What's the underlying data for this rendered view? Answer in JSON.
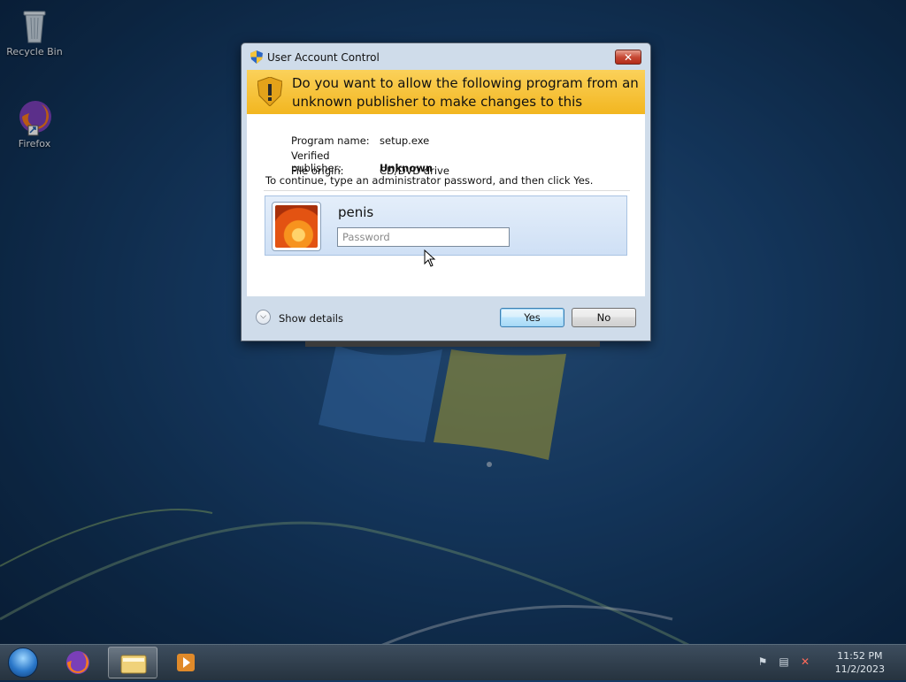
{
  "desktop": {
    "icons": [
      {
        "label": "Recycle Bin",
        "icon": "recycle-bin-icon"
      },
      {
        "label": "Firefox",
        "icon": "firefox-icon"
      }
    ]
  },
  "dialog": {
    "title": "User Account Control",
    "close_label": "✕",
    "banner_text": "Do you want to allow the following program from an unknown publisher to make changes to this computer?",
    "program_name_label": "Program name:",
    "program_name": "setup.exe",
    "publisher_label": "Verified publisher:",
    "publisher": "Unknown",
    "origin_label": "File origin:",
    "origin": "CD/DVD drive",
    "instruction": "To continue, type an administrator password, and then click Yes.",
    "username": "penis",
    "password_placeholder": "Password",
    "show_details": "Show details",
    "yes_label": "Yes",
    "no_label": "No",
    "banner_color": "#f2b620"
  },
  "taskbar": {
    "clock_time": "11:52 PM",
    "clock_date": "11/2/2023",
    "items": [
      {
        "icon": "firefox-icon"
      },
      {
        "icon": "file-explorer-icon",
        "active": true
      },
      {
        "icon": "media-player-icon"
      }
    ],
    "tray": [
      "action-center-flag-icon",
      "network-icon",
      "volume-muted-icon"
    ]
  }
}
